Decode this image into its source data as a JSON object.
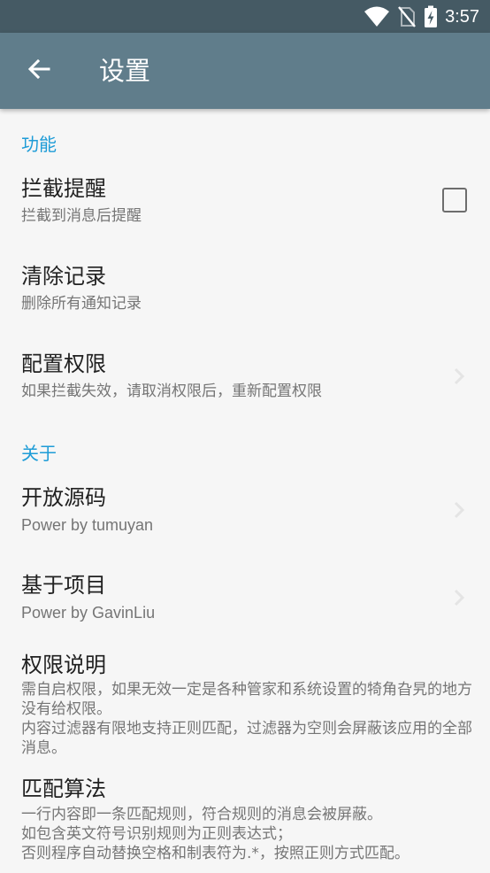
{
  "status_bar": {
    "time": "3:57",
    "icons": [
      "wifi-icon",
      "no-sim-icon",
      "battery-charging-icon"
    ]
  },
  "toolbar": {
    "title": "设置",
    "back_icon": "arrow-back-icon"
  },
  "sections": [
    {
      "header": "功能",
      "items": [
        {
          "title": "拦截提醒",
          "summary": "拦截到消息后提醒",
          "control": "checkbox",
          "checked": false
        },
        {
          "title": "清除记录",
          "summary": "删除所有通知记录"
        },
        {
          "title": "配置权限",
          "summary": "如果拦截失效，请取消权限后，重新配置权限",
          "control": "chevron-right-icon"
        }
      ]
    },
    {
      "header": "关于",
      "items": [
        {
          "title": "开放源码",
          "summary": "Power by tumuyan",
          "control": "chevron-right-icon"
        },
        {
          "title": "基于项目",
          "summary": "Power by GavinLiu",
          "control": "chevron-right-icon"
        },
        {
          "title": "权限说明",
          "summary": "需自启权限，如果无效一定是各种管家和系统设置的犄角旮旯的地方没有给权限。\n内容过滤器有限地支持正则匹配，过滤器为空则会屏蔽该应用的全部消息。"
        },
        {
          "title": "匹配算法",
          "summary": "一行内容即一条匹配规则，符合规则的消息会被屏蔽。\n如包含英文符号识别规则为正则表达式；\n否则程序自动替换空格和制表符为.*，按照正则方式匹配。"
        }
      ]
    }
  ],
  "colors": {
    "status_bar": "#455a64",
    "toolbar": "#607d8b",
    "accent": "#1e9cd7",
    "background": "#f6f6f6"
  }
}
